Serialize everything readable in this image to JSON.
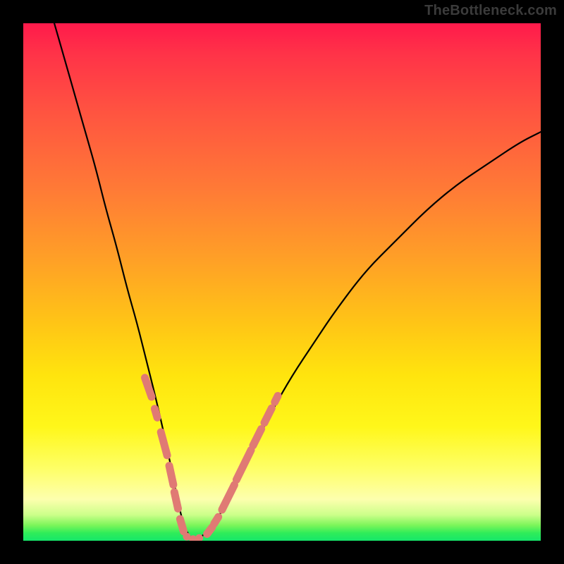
{
  "watermark": "TheBottleneck.com",
  "colors": {
    "frame": "#000000",
    "curve": "#000000",
    "markers": "#e07a74",
    "watermark_text": "#3b3b3b",
    "gradient_stops": [
      "#ff1a4b",
      "#ff3348",
      "#ff5640",
      "#ff7a36",
      "#ffa126",
      "#ffc516",
      "#ffe40e",
      "#fff71a",
      "#feff66",
      "#fdffae",
      "#ccff8a",
      "#7cf55a",
      "#2fed59",
      "#16e66a"
    ]
  },
  "chart_data": {
    "type": "line",
    "title": "",
    "xlabel": "",
    "ylabel": "",
    "xlim": [
      0,
      100
    ],
    "ylim": [
      0,
      100
    ],
    "note": "Single V-shaped bottleneck curve over a vertical performance gradient. x in percent of horizontal span, y in percent bottleneck (0 = bottom/green/good, 100 = top/red/bad). Values estimated from pixel positions.",
    "series": [
      {
        "name": "bottleneck-curve",
        "x": [
          6,
          8,
          10,
          12,
          14,
          16,
          18,
          20,
          22,
          24,
          26,
          28,
          29,
          30,
          31,
          32,
          33,
          34,
          36,
          38,
          40,
          44,
          48,
          52,
          56,
          60,
          66,
          72,
          78,
          84,
          90,
          96,
          100
        ],
        "y": [
          100,
          93,
          86,
          79,
          72,
          64,
          57,
          49,
          42,
          34,
          26,
          17,
          12,
          7,
          3,
          1,
          0,
          0.5,
          2,
          5,
          9,
          17,
          25,
          32,
          38,
          44,
          52,
          58,
          64,
          69,
          73,
          77,
          79
        ]
      }
    ],
    "markers": {
      "description": "Salmon capsule-shaped markers overlaid on the lower portion of the curve near the trough. Coordinates are in the same percent space as the series.",
      "left_branch": [
        {
          "x1": 23.5,
          "y1": 31.5,
          "x2": 24.8,
          "y2": 27.8
        },
        {
          "x1": 25.4,
          "y1": 25.5,
          "x2": 25.9,
          "y2": 23.8
        },
        {
          "x1": 26.6,
          "y1": 21.0,
          "x2": 27.8,
          "y2": 16.5
        },
        {
          "x1": 28.2,
          "y1": 14.5,
          "x2": 29.0,
          "y2": 10.8
        },
        {
          "x1": 29.2,
          "y1": 9.4,
          "x2": 29.9,
          "y2": 6.2
        },
        {
          "x1": 30.3,
          "y1": 4.2,
          "x2": 31.0,
          "y2": 1.8
        }
      ],
      "right_branch": [
        {
          "x1": 35.5,
          "y1": 1.3,
          "x2": 36.5,
          "y2": 2.6
        },
        {
          "x1": 36.9,
          "y1": 3.3,
          "x2": 37.7,
          "y2": 4.6
        },
        {
          "x1": 38.4,
          "y1": 6.0,
          "x2": 40.8,
          "y2": 10.8
        },
        {
          "x1": 41.2,
          "y1": 11.8,
          "x2": 44.0,
          "y2": 17.5
        },
        {
          "x1": 44.4,
          "y1": 18.4,
          "x2": 46.0,
          "y2": 21.6
        },
        {
          "x1": 46.6,
          "y1": 22.8,
          "x2": 48.0,
          "y2": 25.6
        },
        {
          "x1": 48.6,
          "y1": 26.8,
          "x2": 49.2,
          "y2": 28.0
        }
      ],
      "trough_dots": [
        {
          "x": 31.6,
          "y": 0.8
        },
        {
          "x": 32.8,
          "y": 0.3
        },
        {
          "x": 34.0,
          "y": 0.5
        }
      ]
    }
  }
}
